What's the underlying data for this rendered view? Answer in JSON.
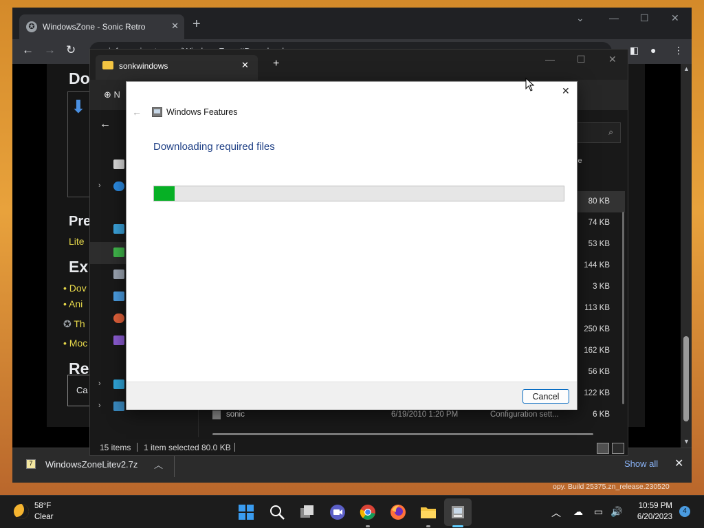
{
  "browser": {
    "tab_title": "WindowsZone - Sonic Retro",
    "url": "info.sonicretro.org/WindowsZone#Downloads",
    "page": {
      "headings": [
        "Do",
        "Pre",
        "Ex",
        "Re"
      ],
      "links": [
        "Lite",
        "Dov",
        "Ani",
        "Th",
        "Moc"
      ],
      "button_fragment": "Ca"
    },
    "download_bar": {
      "file_name": "WindowsZoneLitev2.7z",
      "show_all": "Show all"
    }
  },
  "explorer": {
    "tab_title": "sonkwindows",
    "new_button": "N",
    "column_size_fragment": "ze",
    "sizes": [
      "80 KB",
      "74 KB",
      "53 KB",
      "144 KB",
      "3 KB",
      "113 KB",
      "250 KB",
      "162 KB",
      "56 KB",
      "122 KB"
    ],
    "last_row": {
      "name": "sonic",
      "date": "6/19/2010 1:20 PM",
      "type": "Configuration sett...",
      "size": "6 KB"
    },
    "status": {
      "items": "15 items",
      "selected": "1 item selected",
      "selected_size": "80.0 KB"
    }
  },
  "dialog": {
    "title": "Windows Features",
    "heading": "Downloading required files",
    "progress_percent": 5,
    "progress_color": "#06b025",
    "cancel_label": "Cancel"
  },
  "watermark": "opy. Build 25375.zn_release.230520",
  "taskbar": {
    "weather": {
      "temp": "58°F",
      "condition": "Clear"
    },
    "time": "10:59 PM",
    "date": "6/20/2023",
    "notification_count": "4",
    "apps": [
      "start-icon",
      "search-icon",
      "task-view-icon",
      "meet-icon",
      "chrome-icon",
      "firefox-icon",
      "file-explorer-icon",
      "windows-features-icon"
    ]
  }
}
